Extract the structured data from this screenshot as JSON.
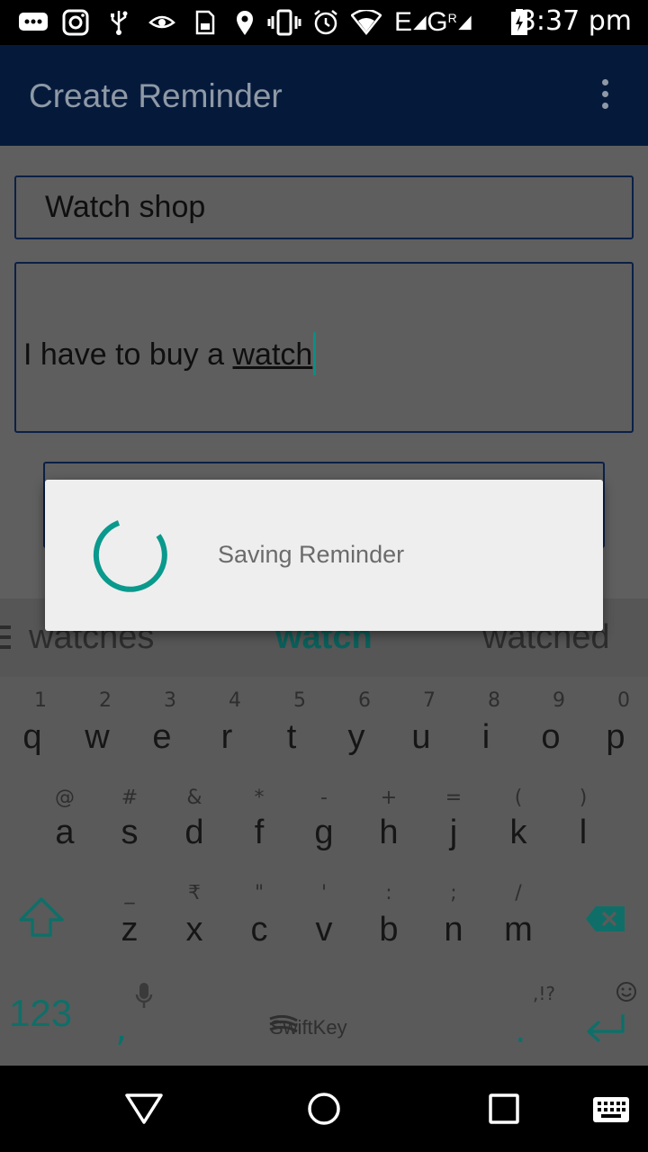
{
  "status_bar": {
    "time": "3:37 pm",
    "network_1": "E",
    "network_2": "G",
    "network_2_sup": "R"
  },
  "app_bar": {
    "title": "Create Reminder"
  },
  "form": {
    "title_value": "Watch shop",
    "description_prefix": "I have to buy a ",
    "description_word": "watch"
  },
  "dialog": {
    "message": "Saving Reminder",
    "accent_color": "#0a998d"
  },
  "keyboard": {
    "suggestions": [
      "watches",
      "watch",
      "watched"
    ],
    "row1": [
      {
        "hint": "1",
        "key": "q"
      },
      {
        "hint": "2",
        "key": "w"
      },
      {
        "hint": "3",
        "key": "e"
      },
      {
        "hint": "4",
        "key": "r"
      },
      {
        "hint": "5",
        "key": "t"
      },
      {
        "hint": "6",
        "key": "y"
      },
      {
        "hint": "7",
        "key": "u"
      },
      {
        "hint": "8",
        "key": "i"
      },
      {
        "hint": "9",
        "key": "o"
      },
      {
        "hint": "0",
        "key": "p"
      }
    ],
    "row2": [
      {
        "hint": "@",
        "key": "a"
      },
      {
        "hint": "#",
        "key": "s"
      },
      {
        "hint": "&",
        "key": "d"
      },
      {
        "hint": "*",
        "key": "f"
      },
      {
        "hint": "-",
        "key": "g"
      },
      {
        "hint": "+",
        "key": "h"
      },
      {
        "hint": "=",
        "key": "j"
      },
      {
        "hint": "(",
        "key": "k"
      },
      {
        "hint": ")",
        "key": "l"
      }
    ],
    "row3": [
      {
        "hint": "_",
        "key": "z"
      },
      {
        "hint": "₹",
        "key": "x"
      },
      {
        "hint": "\"",
        "key": "c"
      },
      {
        "hint": "'",
        "key": "v"
      },
      {
        "hint": ":",
        "key": "b"
      },
      {
        "hint": ";",
        "key": "n"
      },
      {
        "hint": "/",
        "key": "m"
      }
    ],
    "numbers_label": "123",
    "comma": ",",
    "period": ".",
    "period_hint": ",!?",
    "brand": "SwiftKey",
    "accent_color": "#0f6f68"
  },
  "icons": {
    "status": [
      "message-icon",
      "instagram-icon",
      "usb-icon",
      "eye-icon",
      "sd-card-icon",
      "location-icon",
      "vibrate-icon",
      "alarm-icon",
      "wifi-icon",
      "signal-icon",
      "battery-icon"
    ],
    "keyboard": [
      "shift-icon",
      "backspace-icon",
      "mic-icon",
      "emoji-icon",
      "enter-icon"
    ],
    "nav": [
      "back-icon",
      "home-icon",
      "recents-icon",
      "keyboard-switch-icon"
    ]
  }
}
